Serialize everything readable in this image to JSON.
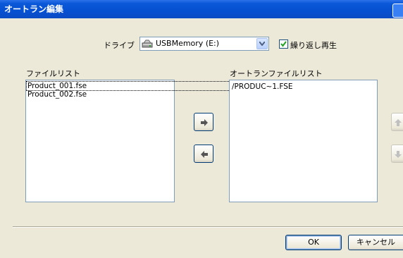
{
  "window": {
    "title": "オートラン編集"
  },
  "drive": {
    "label": "ドライブ",
    "selected": "USBMemory (E:)"
  },
  "repeat": {
    "label": "繰り返し再生",
    "checked": true
  },
  "file_list": {
    "label": "ファイルリスト",
    "items": [
      "Product_001.fse",
      "Product_002.fse"
    ]
  },
  "autorun_list": {
    "label": "オートランファイルリスト",
    "items": [
      "/PRODUC~1.FSE"
    ]
  },
  "buttons": {
    "ok": "OK",
    "cancel": "キャンセル"
  },
  "colors": {
    "titlebar": "#0a58d8",
    "dialog_bg": "#ece9d8",
    "arrow": "#555555",
    "arrow_disabled": "#c0c0c0"
  }
}
